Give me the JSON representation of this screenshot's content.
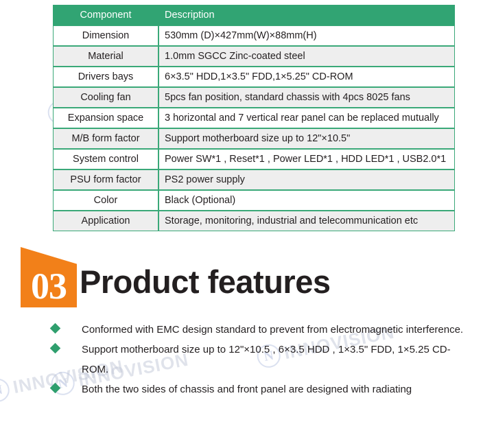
{
  "colors": {
    "table_header_green": "#31a473",
    "table_border_green": "#3aa878",
    "badge_orange": "#f28019",
    "bullet_green": "#2f9f6e",
    "row_alt_gray": "#eeeeee",
    "text_dark": "#231f20"
  },
  "spec_table": {
    "headers": {
      "component": "Component",
      "description": "Description"
    },
    "rows": [
      {
        "component": "Dimension",
        "description": "530mm (D)×427mm(W)×88mm(H)"
      },
      {
        "component": "Material",
        "description": "1.0mm SGCC Zinc-coated steel"
      },
      {
        "component": "Drivers bays",
        "description": "6×3.5\" HDD,1×3.5\" FDD,1×5.25\" CD-ROM"
      },
      {
        "component": "Cooling fan",
        "description": "5pcs fan position, standard chassis with 4pcs 8025 fans"
      },
      {
        "component": "Expansion space",
        "description": "3 horizontal and 7 vertical rear panel can be replaced mutually"
      },
      {
        "component": "M/B form factor",
        "description": "Support motherboard size up to 12\"×10.5\""
      },
      {
        "component": "System control",
        "description": "Power SW*1 , Reset*1 , Power LED*1 , HDD LED*1 , USB2.0*1"
      },
      {
        "component": "PSU form factor",
        "description": "PS2 power supply"
      },
      {
        "component": "Color",
        "description": "Black (Optional)"
      },
      {
        "component": "Application",
        "description": "Storage, monitoring, industrial and telecommunication etc"
      }
    ]
  },
  "section": {
    "number": "03",
    "title": "Product features"
  },
  "features": [
    "Conformed with EMC design standard to prevent from electromagnetic interference.",
    "Support motherboard size up to 12\"×10.5 , 6×3.5 HDD , 1×3.5\" FDD, 1×5.25 CD-ROM.",
    "Both the two sides of chassis and front panel are designed with radiating"
  ],
  "watermarks": [
    {
      "mark": "N",
      "text": "INNOVISION"
    },
    {
      "mark": "N",
      "text": "INNOVISION"
    },
    {
      "mark": "N",
      "text": "INNOVISION"
    },
    {
      "mark": "N",
      "text": "INNOVISION"
    },
    {
      "mark": "N",
      "text": "INNOVISION"
    }
  ]
}
